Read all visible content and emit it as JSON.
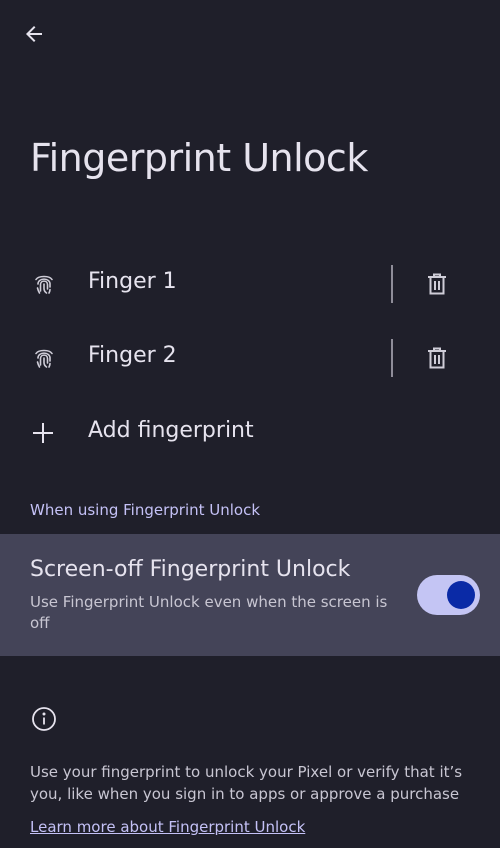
{
  "header": {
    "back_icon": "arrow-left-icon"
  },
  "page_title": "Fingerprint Unlock",
  "fingers": [
    {
      "label": "Finger 1",
      "icon": "fingerprint-icon",
      "delete_icon": "trash-icon"
    },
    {
      "label": "Finger 2",
      "icon": "fingerprint-icon",
      "delete_icon": "trash-icon"
    }
  ],
  "add_fingerprint": {
    "label": "Add fingerprint",
    "icon": "plus-icon"
  },
  "section": {
    "header": "When using Fingerprint Unlock"
  },
  "screen_off": {
    "title": "Screen-off Fingerprint Unlock",
    "subtitle": "Use Fingerprint Unlock even when the screen is off",
    "enabled": true
  },
  "info": {
    "icon": "info-icon",
    "text": "Use your fingerprint to unlock your Pixel or verify that it’s you, like when you sign in to apps or approve a purchase",
    "link": "Learn more about Fingerprint Unlock"
  },
  "colors": {
    "background": "#1f1f2a",
    "highlight_row": "#444458",
    "accent": "#c4c1f6",
    "switch_track": "#c4c5f4",
    "switch_thumb": "#0a2aa6"
  }
}
